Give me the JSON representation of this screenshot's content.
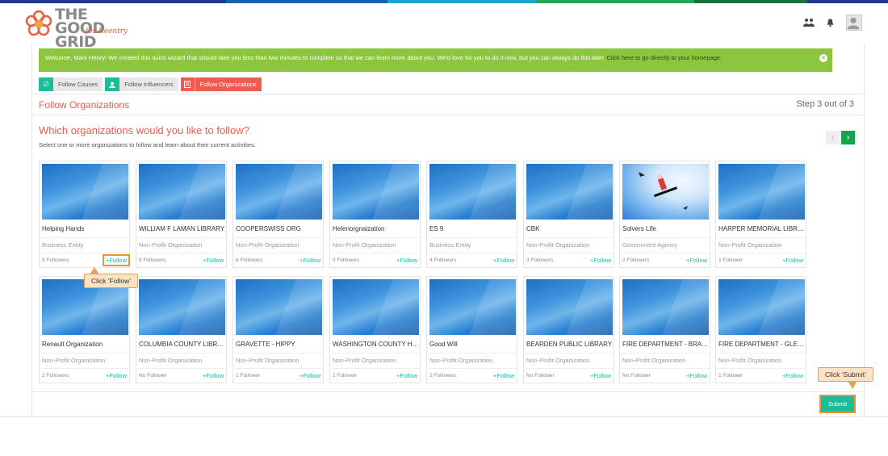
{
  "brand": {
    "logo_line1": "THE GOOD",
    "logo_line2": "GRID",
    "logo_sub": "for Reentry",
    "stripe_colors": [
      "#1e3a8a",
      "#1c5fae",
      "#1aa7c9",
      "#22a652",
      "#1d6f3a",
      "#1e3a8a"
    ]
  },
  "header_icons": [
    "people-icon",
    "bell-icon",
    "user-avatar"
  ],
  "banner": {
    "text": "Welcome, Mark Henry! We created this quick wizard that should take you less than two minutes to complete so that we can learn more about you. We'd love for you to do it now, but you can always do this later.",
    "link": "Click here to go directly to your homepage.",
    "close": "×"
  },
  "steps": [
    {
      "label": "Follow Causes",
      "icon": "☑"
    },
    {
      "label": "Follow Influencers",
      "icon": "👤"
    },
    {
      "label": "Follow Organizations",
      "icon": "▦"
    }
  ],
  "section_title": "Follow Organizations",
  "step_count": "Step 3 out of 3",
  "question": "Which organizations would you like to follow?",
  "question_sub": "Select one or more organizations to follow and learn about their current activities.",
  "pager": {
    "prev": "‹",
    "next": "›"
  },
  "follow_label": "+Follow",
  "organizations": [
    {
      "name": "Helping Hands",
      "type": "Business Entity",
      "followers": "9 Followers"
    },
    {
      "name": "WILLIAM F LAMAN LIBRARY",
      "type": "Non-Profit Organization",
      "followers": "8 Followers"
    },
    {
      "name": "COOPERSWISS ORG",
      "type": "Non-Profit Organization",
      "followers": "6 Followers"
    },
    {
      "name": "Helenorgnaization",
      "type": "Non-Profit Organization",
      "followers": "5 Followers"
    },
    {
      "name": "ES 9",
      "type": "Business Entity",
      "followers": "4 Followers"
    },
    {
      "name": "CBK",
      "type": "Non-Profit Organization",
      "followers": "3 Followers"
    },
    {
      "name": "Solvers Life",
      "type": "Government Agency",
      "followers": "2 Followers"
    },
    {
      "name": "HARPER MEMORIAL LIBRARY",
      "type": "Non-Profit Organization",
      "followers": "1 Follower"
    },
    {
      "name": "Renault Organization",
      "type": "Non-Profit Organization",
      "followers": "2 Followers"
    },
    {
      "name": "COLUMBIA COUNTY LIBRAR...",
      "type": "Non-Profit Organization",
      "followers": "No Follower"
    },
    {
      "name": "GRAVETTE - HIPPY",
      "type": "Non-Profit Organization",
      "followers": "1 Follower"
    },
    {
      "name": "WASHINGTON COUNTY HIV ...",
      "type": "Non-Profit Organization",
      "followers": "1 Follower"
    },
    {
      "name": "Good Will",
      "type": "Non-Profit Organization",
      "followers": "2 Followers"
    },
    {
      "name": "BEARDEN PUBLIC LIBRARY",
      "type": "Non-Profit Organization",
      "followers": "No Follower"
    },
    {
      "name": "FIRE DEPARTMENT - BRAD...",
      "type": "Non-Profit Organization",
      "followers": "No Follower"
    },
    {
      "name": "FIRE DEPARTMENT - GLEN...",
      "type": "Non-Profit Organization",
      "followers": "1 Follower"
    }
  ],
  "callouts": {
    "follow": "Click ‘Follow’",
    "submit": "Click ‘Submit’"
  },
  "submit_label": "Submit"
}
